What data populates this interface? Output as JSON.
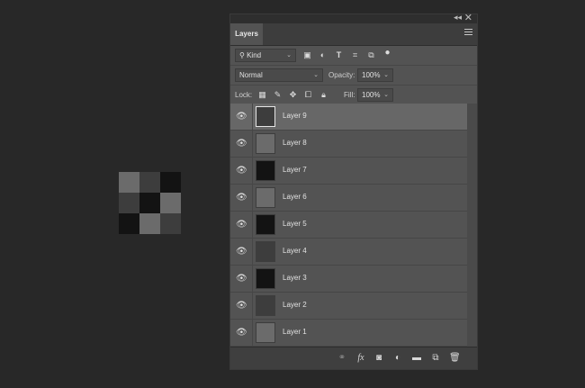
{
  "canvas_preview": {
    "cells": [
      "#6b6b6b",
      "#3d3d3d",
      "#131313",
      "#3d3d3d",
      "#131313",
      "#6b6b6b",
      "#131313",
      "#6b6b6b",
      "#3d3d3d"
    ]
  },
  "panel": {
    "tab_label": "Layers",
    "filter_kind": "Kind",
    "blend_mode": "Normal",
    "opacity_label": "Opacity:",
    "opacity_value": "100%",
    "lock_label": "Lock:",
    "fill_label": "Fill:",
    "fill_value": "100%",
    "filter_icons": [
      "pixel-layer-filter-icon",
      "adjustment-layer-filter-icon",
      "type-layer-filter-icon",
      "shape-layer-filter-icon",
      "smart-object-filter-icon",
      "filter-toggle-icon"
    ],
    "lock_icons": [
      "lock-transparent-pixels-icon",
      "lock-image-pixels-icon",
      "lock-position-icon",
      "lock-artboard-icon",
      "lock-all-icon"
    ],
    "footer_icons": [
      "link-layers-icon",
      "fx-icon",
      "add-mask-icon",
      "new-adjustment-layer-icon",
      "new-group-icon",
      "new-layer-icon",
      "delete-layer-icon"
    ]
  },
  "layers": [
    {
      "name": "Layer 9",
      "color": "#3d3d3d",
      "selected": true
    },
    {
      "name": "Layer 8",
      "color": "#6b6b6b",
      "selected": false
    },
    {
      "name": "Layer 7",
      "color": "#131313",
      "selected": false
    },
    {
      "name": "Layer 6",
      "color": "#6b6b6b",
      "selected": false
    },
    {
      "name": "Layer 5",
      "color": "#131313",
      "selected": false
    },
    {
      "name": "Layer 4",
      "color": "#3d3d3d",
      "selected": false
    },
    {
      "name": "Layer 3",
      "color": "#131313",
      "selected": false
    },
    {
      "name": "Layer 2",
      "color": "#3d3d3d",
      "selected": false
    },
    {
      "name": "Layer 1",
      "color": "#6b6b6b",
      "selected": false
    }
  ]
}
